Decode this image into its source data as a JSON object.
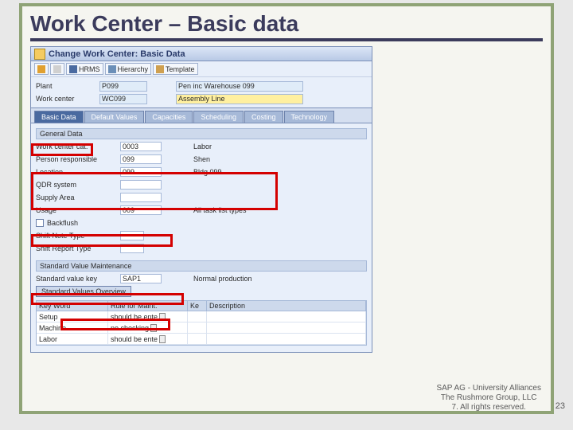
{
  "slide_title": "Work Center – Basic data",
  "window_title": "Change Work Center: Basic Data",
  "toolbar": {
    "hrms": "HRMS",
    "hierarchy": "Hierarchy",
    "template": "Template"
  },
  "header": {
    "plant_label": "Plant",
    "plant_value": "P099",
    "plant_desc": "Pen inc Warehouse 099",
    "wc_label": "Work center",
    "wc_value": "WC099",
    "wc_desc": "Assembly Line"
  },
  "tabs": {
    "basic": "Basic Data",
    "defaults": "Default Values",
    "capacities": "Capacities",
    "scheduling": "Scheduling",
    "costing": "Costing",
    "technology": "Technology"
  },
  "general": {
    "section": "General Data",
    "rows": [
      {
        "label": "Work center cat.",
        "value": "0003",
        "desc": "Labor"
      },
      {
        "label": "Person responsible",
        "value": "099",
        "desc": "Shen"
      },
      {
        "label": "Location",
        "value": "099",
        "desc": "Bldg 099"
      },
      {
        "label": "QDR system",
        "value": "",
        "desc": ""
      },
      {
        "label": "Supply Area",
        "value": "",
        "desc": ""
      },
      {
        "label": "Usage",
        "value": "009",
        "desc": "All task list types"
      }
    ],
    "backflush": "Backflush",
    "shift_note": "Shift Note Type",
    "shift_report": "Shift Report Type"
  },
  "svm": {
    "section": "Standard Value Maintenance",
    "svk_label": "Standard value key",
    "svk_value": "SAP1",
    "svk_desc": "Normal production",
    "svo_btn": "Standard Values Overview"
  },
  "table": {
    "h1": "Key Word",
    "h2": "Rule for Maint.",
    "h3": "Ke",
    "h4": "Description",
    "rows": [
      {
        "kw": "Setup",
        "rule": "should be ente"
      },
      {
        "kw": "Machine",
        "rule": "no checking"
      },
      {
        "kw": "Labor",
        "rule": "should be ente"
      }
    ]
  },
  "footer": {
    "l1": "SAP AG - University Alliances",
    "l2": "The Rushmore Group, LLC",
    "l3": "7. All rights reserved."
  },
  "page_number": "23"
}
